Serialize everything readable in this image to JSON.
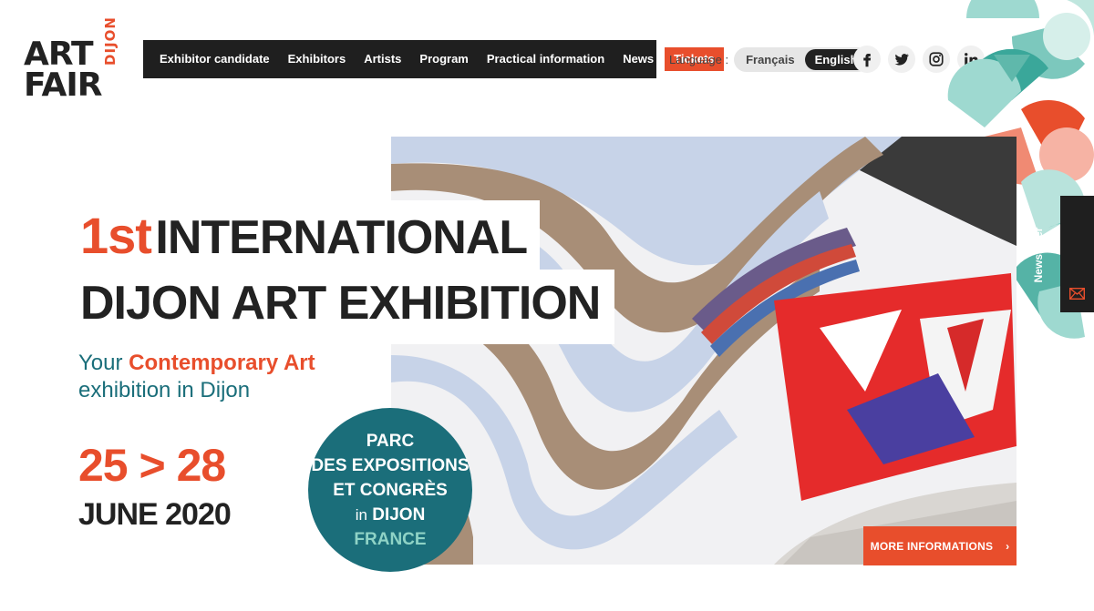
{
  "logo": {
    "line1": "ART",
    "line2": "FAIR",
    "vertical": "DIJON"
  },
  "nav": {
    "items": [
      "Exhibitor candidate",
      "Exhibitors",
      "Artists",
      "Program",
      "Practical information",
      "News"
    ],
    "tickets": "Tickets"
  },
  "language": {
    "label": "Language :",
    "options": [
      "Français",
      "English"
    ],
    "active": "English"
  },
  "social": [
    "facebook-icon",
    "twitter-icon",
    "instagram-icon",
    "linkedin-icon"
  ],
  "headline": {
    "ordinal": "1st",
    "line1": "INTERNATIONAL",
    "line2": "DIJON ART EXHIBITION"
  },
  "subtitle": {
    "prefix": "Your",
    "highlight": "Contemporary Art",
    "suffix": "exhibition in Dijon"
  },
  "dates": "25 > 28",
  "month_year": "JUNE 2020",
  "venue": {
    "line1": "PARC",
    "line2": "DES EXPOSITIONS",
    "line3": "ET CONGRÈS",
    "in": "in",
    "city": "DIJON",
    "country": "FRANCE"
  },
  "more_button": {
    "label": "MORE INFORMATIONS",
    "arrow": "›"
  },
  "newsletter": {
    "label": "Newsletter"
  },
  "colors": {
    "accent": "#e84e2c",
    "teal": "#1b6e7a",
    "dark": "#1f1f1f",
    "mint": "#8fd3c6"
  }
}
